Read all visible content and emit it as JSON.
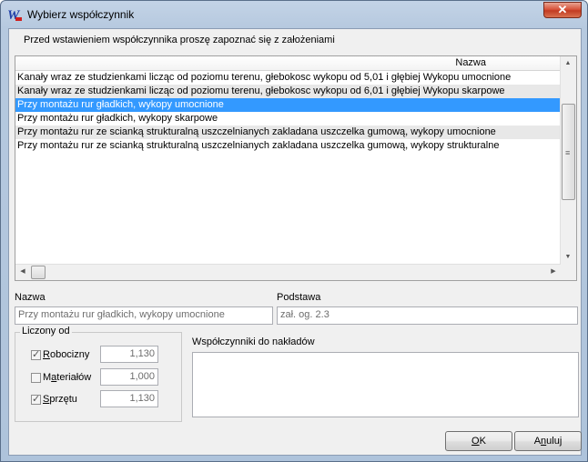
{
  "window": {
    "title": "Wybierz współczynnik",
    "close_label": "✕"
  },
  "info_text": "Przed wstawieniem współczynnika proszę zapoznać się z założeniami",
  "list": {
    "column_header": "Nazwa",
    "rows": [
      "Kanały  wraz ze studzienkami licząc od poziomu terenu, głebokosc wykopu od 5,01 i głębiej Wykopu umocnione",
      "Kanały  wraz ze studzienkami licząc od poziomu terenu, głebokosc wykopu od 6,01 i głębiej Wykopu skarpowe",
      "Przy montażu rur gładkich, wykopy umocnione",
      "Przy montażu rur gładkich, wykopy skarpowe",
      "Przy montażu rur ze scianką strukturalną uszczelnianych zakladana uszczelka gumową, wykopy umocnione",
      "Przy montażu rur ze scianką strukturalną uszczelnianych zakladana uszczelka gumową, wykopy strukturalne"
    ],
    "selected_index": 2
  },
  "fields": {
    "nazwa_label": "Nazwa",
    "nazwa_value": "Przy montażu rur gładkich, wykopy umocnione",
    "podstawa_label": "Podstawa",
    "podstawa_value": "zał. og. 2.3"
  },
  "liczony_od": {
    "title": "Liczony od",
    "items": [
      {
        "label_prefix": "",
        "label_accel": "R",
        "label_rest": "obocizny",
        "checked": true,
        "value": "1,130"
      },
      {
        "label_prefix": "M",
        "label_accel": "a",
        "label_rest": "teriałów",
        "checked": false,
        "value": "1,000"
      },
      {
        "label_prefix": "",
        "label_accel": "S",
        "label_rest": "przętu",
        "checked": true,
        "value": "1,130"
      }
    ]
  },
  "wspolczynniki_label": "Współczynniki do nakładów",
  "buttons": {
    "ok_accel": "O",
    "ok_rest": "K",
    "cancel_prefix": "A",
    "cancel_accel": "n",
    "cancel_rest": "uluj"
  },
  "colors": {
    "selection": "#3399ff",
    "close_button": "#c9432a"
  },
  "icons": {
    "app": "W-logo-icon",
    "close": "close-icon",
    "check": "checkmark-icon"
  }
}
